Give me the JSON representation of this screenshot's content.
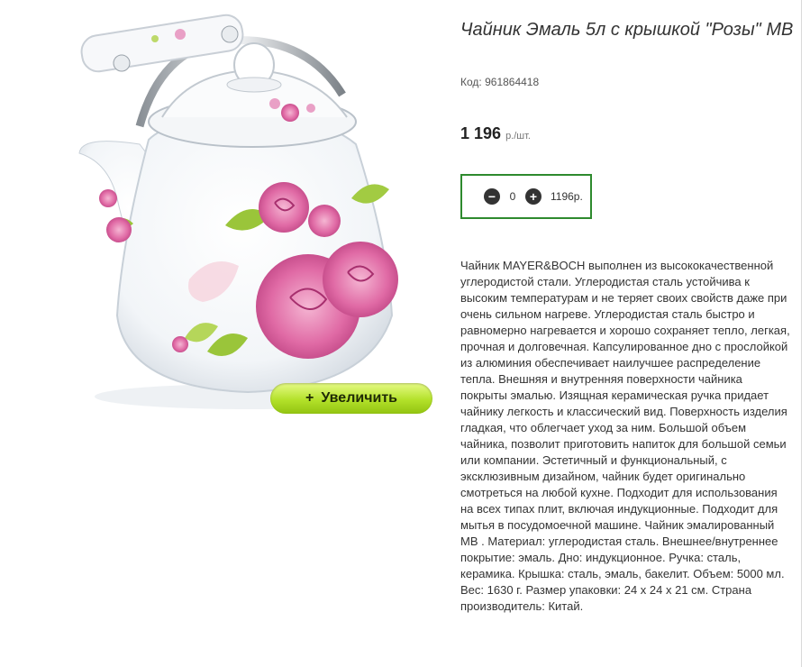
{
  "product": {
    "title": "Чайник Эмаль 5л с крышкой \"Розы\" МВ",
    "sku_label": "Код:",
    "sku": "961864418",
    "price": "1 196",
    "price_unit": "р./шт.",
    "zoom_button": {
      "plus": "+",
      "label": "Увеличить"
    }
  },
  "cart": {
    "minus": "−",
    "quantity": "0",
    "plus": "+",
    "total": "1196р."
  },
  "description": "Чайник MAYER&BOCH выполнен из высококачественной углеродистой стали. Углеродистая сталь устойчива к высоким температурам и не теряет своих свойств даже при очень сильном нагреве. Углеродистая сталь быстро и равномерно нагревается и хорошо сохраняет тепло, легкая, прочная и долговечная. Капсулированное дно с прослойкой из алюминия обеспечивает наилучшее распределение тепла. Внешняя и внутренняя поверхности чайника покрыты эмалью. Изящная керамическая ручка придает чайнику легкость и классический вид. Поверхность изделия гладкая, что облегчает уход за ним. Большой объем чайника, позволит приготовить напиток для большой семьи или компании. Эстетичный и функциональный, с эксклюзивным дизайном, чайник будет оригинально смотреться на любой кухне. Подходит для использования на всех типах плит, включая индукционные. Подходит для мытья в посудомоечной машине. Чайник эмалированный МВ . Материал: углеродистая сталь. Внешнее/внутреннее покрытие: эмаль. Дно: индукционное. Ручка: сталь, керамика. Крышка: сталь, эмаль, бакелит. Объем: 5000 мл. Вес: 1630 г. Размер упаковки: 24 х 24 х 21 см. Страна производитель: Китай.",
  "colors": {
    "qty_border": "#2e8a2e",
    "zoom_button": "#b3e12a",
    "rose": "#d9539a",
    "leaf": "#9ac53a"
  }
}
